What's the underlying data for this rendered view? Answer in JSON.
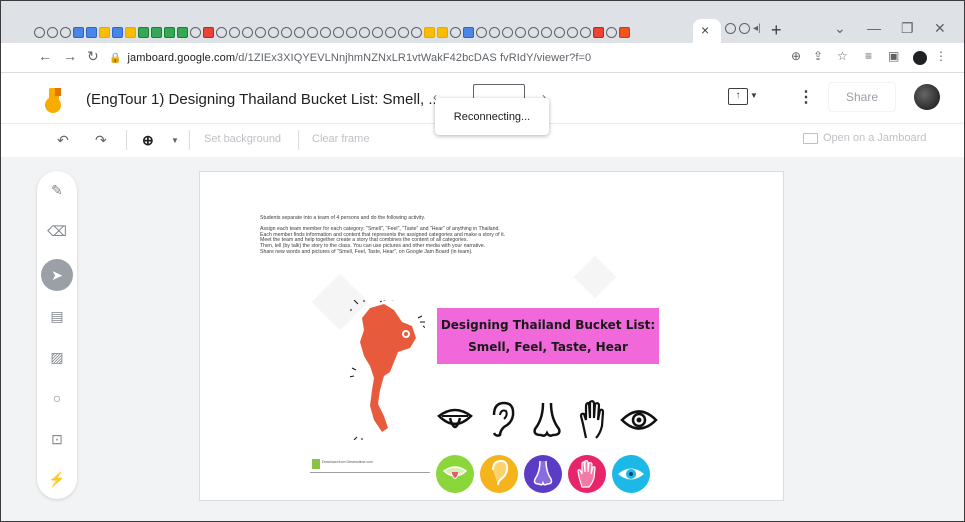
{
  "browser": {
    "url_host": "jamboard.google.com",
    "url_path": "/d/1ZIEx3XIQYEVLNnjhmNZNxLR1vtWakF42bcDAS fvRIdY/viewer?f=0",
    "new_tab_label": "+",
    "close_tab_label": "×",
    "minimize_label": "—",
    "restore_label": "❐",
    "close_window_label": "✕",
    "dropdown_label": "⌄"
  },
  "header": {
    "title": "(EngTour 1) Designing Thailand Bucket List: Smell, ...",
    "share_label": "Share",
    "toast": "Reconnecting..."
  },
  "toolbar": {
    "set_background": "Set background",
    "clear_frame": "Clear frame",
    "open_on_jamboard": "Open on a Jamboard"
  },
  "board": {
    "instructions": [
      "Students separate into a team of 4 persons and do the following activity.",
      "",
      "Assign each team member for each category: \"Smell\", \"Feel\", \"Taste\" and \"Hear\" of anything in Thailand.",
      "Each member finds information and content that represents the assigned categories and make a story of it.",
      "Meet the team and help together create a story that combines the content of all categories.",
      "Then, tell (by talk) the story to the class. You can use pictures and other media with your narrative.",
      "Share new words and pictures of \"Smell, Feel, Taste, Hear\", on Google Jam Board (in team)."
    ],
    "banner_line1": "Designing Thailand Bucket List:",
    "banner_line2": "Smell, Feel, Taste, Hear",
    "credit_text": "Download from Dreamstime.com",
    "sense_colors": [
      "#8bd63b",
      "#f5b31c",
      "#5b3cc4",
      "#e8246a",
      "#1cb8e8"
    ]
  }
}
